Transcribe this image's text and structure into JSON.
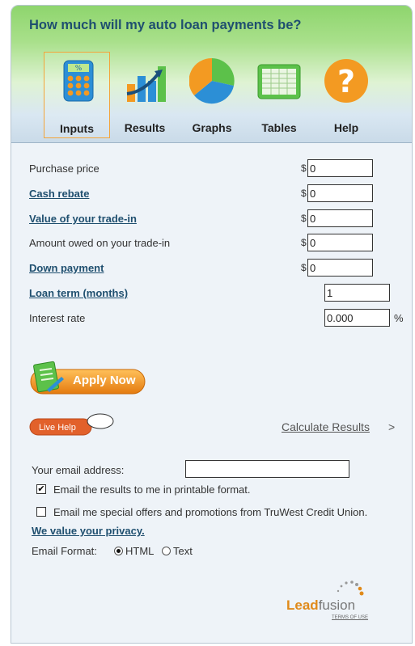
{
  "header": {
    "title": "How much will my auto loan payments be?"
  },
  "nav": [
    {
      "label": "Inputs",
      "icon": "calculator-icon"
    },
    {
      "label": "Results",
      "icon": "bar-chart-icon"
    },
    {
      "label": "Graphs",
      "icon": "pie-chart-icon"
    },
    {
      "label": "Tables",
      "icon": "table-icon"
    },
    {
      "label": "Help",
      "icon": "question-icon"
    }
  ],
  "fields": [
    {
      "label": "Purchase price",
      "value": "0",
      "prefix": "$"
    },
    {
      "label": "Cash rebate",
      "value": "0",
      "prefix": "$"
    },
    {
      "label": "Value of your trade-in",
      "value": "0",
      "prefix": "$"
    },
    {
      "label": "Amount owed on your trade-in",
      "value": "0",
      "prefix": "$"
    },
    {
      "label": "Down payment",
      "value": "0",
      "prefix": "$"
    },
    {
      "label": "Loan term (months)",
      "value": "1"
    },
    {
      "label": "Interest rate",
      "value": "0.000",
      "suffix": "%"
    }
  ],
  "apply": {
    "label": "Apply Now"
  },
  "live_help": {
    "label": "Live Help"
  },
  "calculate": {
    "label": "Calculate Results",
    "arrow": ">"
  },
  "email": {
    "label": "Your email address:",
    "value": "",
    "opt_printable": {
      "label": "Email the results to me in printable format.",
      "checked": true,
      "mark": "✔"
    },
    "opt_offers": {
      "label": "Email me special offers and promotions from TruWest Credit Union.",
      "checked": false,
      "mark": ""
    },
    "privacy": "We value your privacy.",
    "format_label": "Email Format:",
    "format_html": "HTML",
    "format_text": "Text",
    "format_selected": "HTML"
  },
  "brand": {
    "lead": "Lead",
    "fusion": "fusion",
    "terms": "TERMS OF USE"
  },
  "colors": {
    "accent_orange": "#f3a43a",
    "title_blue": "#1f4f6f",
    "header_green": "#8ed56d"
  }
}
